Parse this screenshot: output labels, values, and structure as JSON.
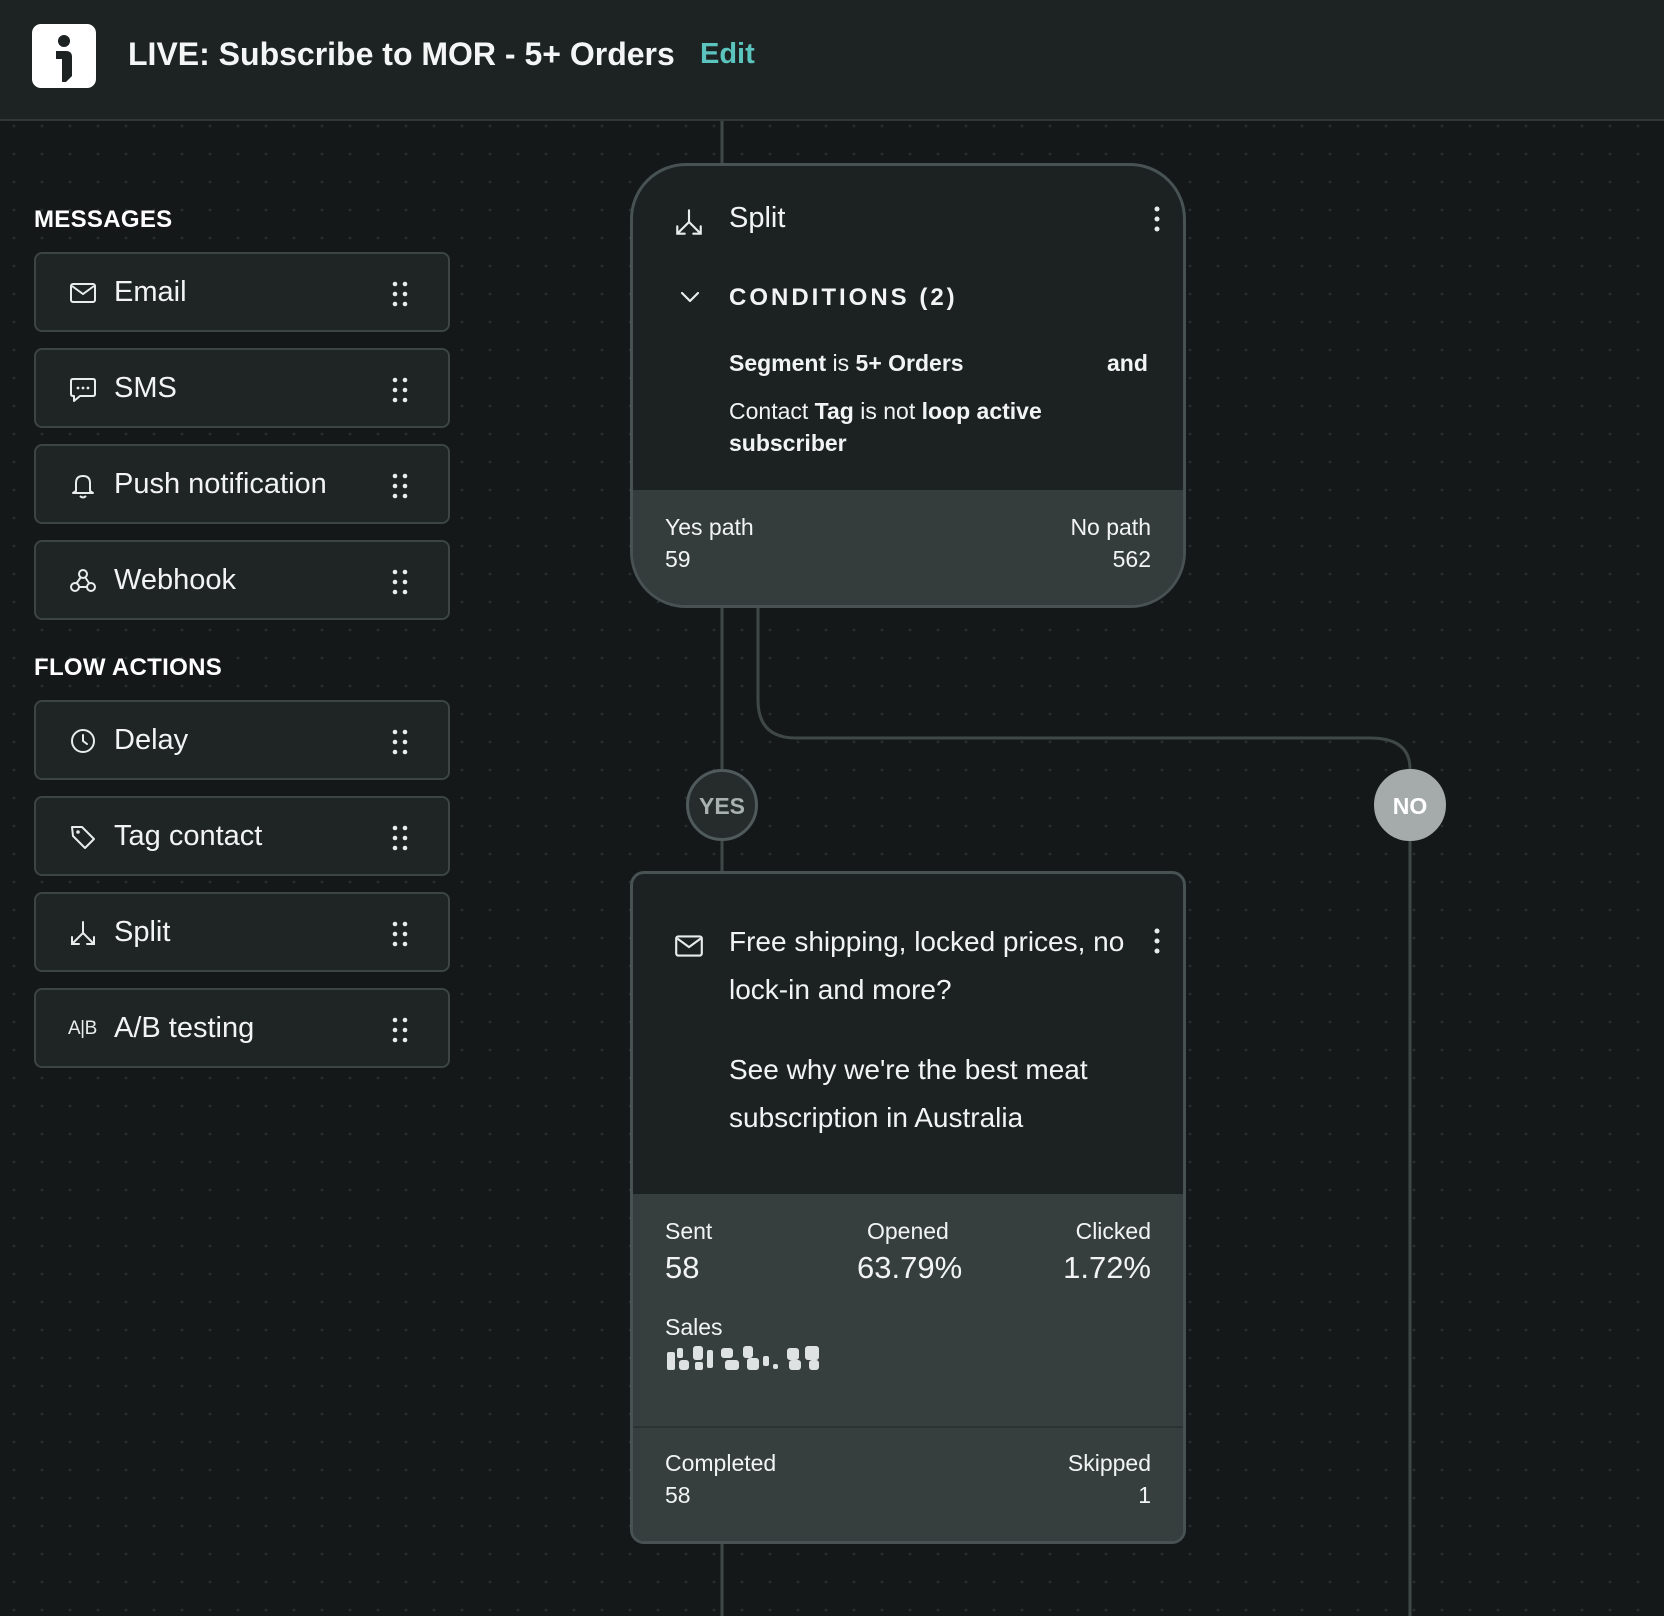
{
  "header": {
    "title": "LIVE: Subscribe to MOR - 5+ Orders",
    "edit_label": "Edit"
  },
  "sidebar": {
    "messages_label": "MESSAGES",
    "messages": [
      {
        "label": "Email",
        "icon": "mail-icon"
      },
      {
        "label": "SMS",
        "icon": "chat-bubble-icon"
      },
      {
        "label": "Push notification",
        "icon": "bell-icon"
      },
      {
        "label": "Webhook",
        "icon": "webhook-icon"
      }
    ],
    "actions_label": "FLOW ACTIONS",
    "actions": [
      {
        "label": "Delay",
        "icon": "clock-icon"
      },
      {
        "label": "Tag contact",
        "icon": "tag-icon"
      },
      {
        "label": "Split",
        "icon": "split-icon"
      },
      {
        "label": "A/B testing",
        "icon": "ab-test-icon",
        "icon_text": "A|B"
      }
    ]
  },
  "split_node": {
    "title": "Split",
    "conditions_label": "CONDITIONS (2)",
    "condition1": {
      "subject": "Segment",
      "op": "is",
      "value": "5+ Orders",
      "joiner": "and"
    },
    "condition2": {
      "prefix": "Contact",
      "subject": "Tag",
      "op": "is not",
      "value_line1": "loop active",
      "value_line2": "subscriber"
    },
    "yes_path_label": "Yes path",
    "yes_path_value": "59",
    "no_path_label": "No path",
    "no_path_value": "562"
  },
  "branches": {
    "yes_label": "YES",
    "no_label": "NO"
  },
  "email_node": {
    "subject_line1": "Free shipping, locked prices, no",
    "subject_line2": "lock-in and more?",
    "preview_line1": "See why we're the best meat",
    "preview_line2": "subscription in Australia",
    "sent_label": "Sent",
    "sent_value": "58",
    "opened_label": "Opened",
    "opened_value": "63.79%",
    "clicked_label": "Clicked",
    "clicked_value": "1.72%",
    "sales_label": "Sales",
    "completed_label": "Completed",
    "completed_value": "58",
    "skipped_label": "Skipped",
    "skipped_value": "1"
  },
  "colors": {
    "accent": "#5cc4be",
    "canvas": "#141818",
    "card": "#1c2222",
    "card_footer": "#373e3e",
    "no_pill": "#a5abab"
  }
}
